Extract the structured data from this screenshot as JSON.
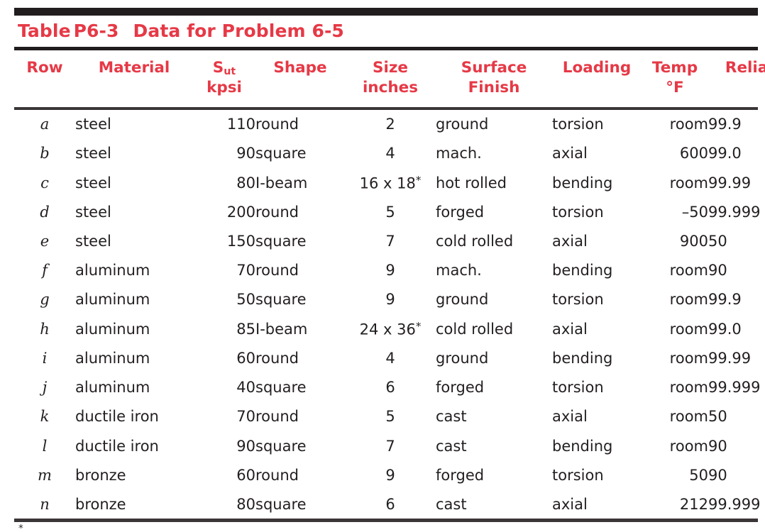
{
  "figure": {
    "caption_label": "Table",
    "caption_number": "P6-3",
    "caption_title": "Data for Problem 6-5",
    "accent_color": "#e63946",
    "rule_color": "#211d1e"
  },
  "footnote": {
    "marker": "*",
    "text": ""
  },
  "chart_data": {
    "type": "table",
    "title": "Table P6-3  Data for Problem 6-5",
    "columns": [
      {
        "key": "row",
        "label": "Row",
        "sub": "",
        "align": "center"
      },
      {
        "key": "material",
        "label": "Material",
        "sub": "",
        "align": "left"
      },
      {
        "key": "sut",
        "label": "Sut",
        "sub": "kpsi",
        "align": "right"
      },
      {
        "key": "shape",
        "label": "Shape",
        "sub": "",
        "align": "left"
      },
      {
        "key": "size",
        "label": "Size",
        "sub": "inches",
        "align": "center"
      },
      {
        "key": "surface",
        "label": "Surface",
        "sub": "Finish",
        "align": "left"
      },
      {
        "key": "loading",
        "label": "Loading",
        "sub": "",
        "align": "left"
      },
      {
        "key": "temp",
        "label": "Temp",
        "sub": "°F",
        "align": "right"
      },
      {
        "key": "reliability",
        "label": "Reliability",
        "sub": "",
        "align": "left"
      }
    ],
    "rows": [
      {
        "row": "a",
        "material": "steel",
        "sut": "110",
        "shape": "round",
        "size": "2",
        "size_star": false,
        "surface": "ground",
        "loading": "torsion",
        "temp": "room",
        "reliability": "99.9"
      },
      {
        "row": "b",
        "material": "steel",
        "sut": "90",
        "shape": "square",
        "size": "4",
        "size_star": false,
        "surface": "mach.",
        "loading": "axial",
        "temp": "600",
        "reliability": "99.0"
      },
      {
        "row": "c",
        "material": "steel",
        "sut": "80",
        "shape": "I-beam",
        "size": "16 x 18",
        "size_star": true,
        "surface": "hot rolled",
        "loading": "bending",
        "temp": "room",
        "reliability": "99.99"
      },
      {
        "row": "d",
        "material": "steel",
        "sut": "200",
        "shape": "round",
        "size": "5",
        "size_star": false,
        "surface": "forged",
        "loading": "torsion",
        "temp": "–50",
        "reliability": "99.999"
      },
      {
        "row": "e",
        "material": "steel",
        "sut": "150",
        "shape": "square",
        "size": "7",
        "size_star": false,
        "surface": "cold rolled",
        "loading": "axial",
        "temp": "900",
        "reliability": "50"
      },
      {
        "row": "f",
        "material": "aluminum",
        "sut": "70",
        "shape": "round",
        "size": "9",
        "size_star": false,
        "surface": "mach.",
        "loading": "bending",
        "temp": "room",
        "reliability": "90"
      },
      {
        "row": "g",
        "material": "aluminum",
        "sut": "50",
        "shape": "square",
        "size": "9",
        "size_star": false,
        "surface": "ground",
        "loading": "torsion",
        "temp": "room",
        "reliability": "99.9"
      },
      {
        "row": "h",
        "material": "aluminum",
        "sut": "85",
        "shape": "I-beam",
        "size": "24 x 36",
        "size_star": true,
        "surface": "cold rolled",
        "loading": "axial",
        "temp": "room",
        "reliability": "99.0"
      },
      {
        "row": "i",
        "material": "aluminum",
        "sut": "60",
        "shape": "round",
        "size": "4",
        "size_star": false,
        "surface": "ground",
        "loading": "bending",
        "temp": "room",
        "reliability": "99.99"
      },
      {
        "row": "j",
        "material": "aluminum",
        "sut": "40",
        "shape": "square",
        "size": "6",
        "size_star": false,
        "surface": "forged",
        "loading": "torsion",
        "temp": "room",
        "reliability": "99.999"
      },
      {
        "row": "k",
        "material": "ductile iron",
        "sut": "70",
        "shape": "round",
        "size": "5",
        "size_star": false,
        "surface": "cast",
        "loading": "axial",
        "temp": "room",
        "reliability": "50"
      },
      {
        "row": "l",
        "material": "ductile iron",
        "sut": "90",
        "shape": "square",
        "size": "7",
        "size_star": false,
        "surface": "cast",
        "loading": "bending",
        "temp": "room",
        "reliability": "90"
      },
      {
        "row": "m",
        "material": "bronze",
        "sut": "60",
        "shape": "round",
        "size": "9",
        "size_star": false,
        "surface": "forged",
        "loading": "torsion",
        "temp": "50",
        "reliability": "90"
      },
      {
        "row": "n",
        "material": "bronze",
        "sut": "80",
        "shape": "square",
        "size": "6",
        "size_star": false,
        "surface": "cast",
        "loading": "axial",
        "temp": "212",
        "reliability": "99.999"
      }
    ]
  }
}
